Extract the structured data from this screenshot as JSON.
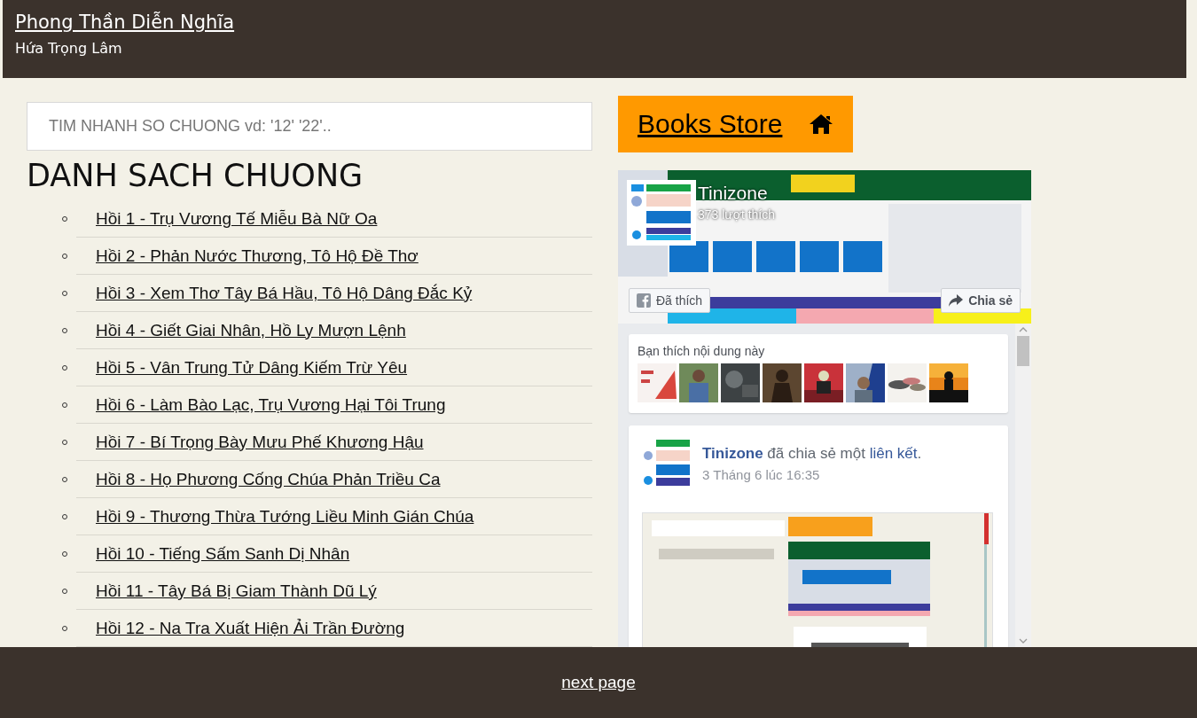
{
  "header": {
    "title": "Phong Thần Diễn Nghĩa",
    "author": "Hứa Trọng Lâm"
  },
  "search": {
    "placeholder": "TIM NHANH SO CHUONG vd: '12' '22'.."
  },
  "chapter_list": {
    "heading": "DANH SACH CHUONG",
    "chapters": [
      "Hồi 1 - Trụ Vương Tế Miễu Bà Nữ Oa",
      "Hồi 2 - Phản Nước Thương, Tô Hộ Đề Thơ",
      "Hồi 3 - Xem Thơ Tây Bá Hầu, Tô Hộ Dâng Đắc Kỷ",
      "Hồi 4 - Giết Giai Nhân, Hồ Ly Mượn Lệnh",
      "Hồi 5 - Vân Trung Tử Dâng Kiếm Trừ Yêu",
      "Hồi 6 - Làm Bào Lạc, Trụ Vương Hại Tôi Trung",
      "Hồi 7 - Bí Trọng Bày Mưu Phế Khương Hậu",
      "Hồi 8 - Họ Phương Cống Chúa Phản Triều Ca",
      "Hồi 9 - Thương Thừa Tướng Liều Minh Gián Chúa",
      "Hồi 10 - Tiếng Sấm Sanh Dị Nhân",
      "Hồi 11 - Tây Bá Bị Giam Thành Dũ Lý",
      "Hồi 12 - Na Tra Xuất Hiện Ải Trần Đường"
    ]
  },
  "store_button": {
    "label": "Books Store"
  },
  "facebook_widget": {
    "page_name": "Tinizone",
    "likes": "373 lượt thích",
    "like_button": "Đã thích",
    "share_button": "Chia sẻ",
    "friends_card": {
      "title": "Bạn thích nội dung này"
    },
    "post": {
      "parts": [
        {
          "kind": "author",
          "text": "Tinizone"
        },
        {
          "kind": "text",
          "text": " đã chia sẻ một "
        },
        {
          "kind": "link",
          "text": "liên kết"
        },
        {
          "kind": "text",
          "text": "."
        }
      ],
      "time": "3 Tháng 6 lúc 16:35"
    }
  },
  "footer": {
    "link": "next page"
  }
}
